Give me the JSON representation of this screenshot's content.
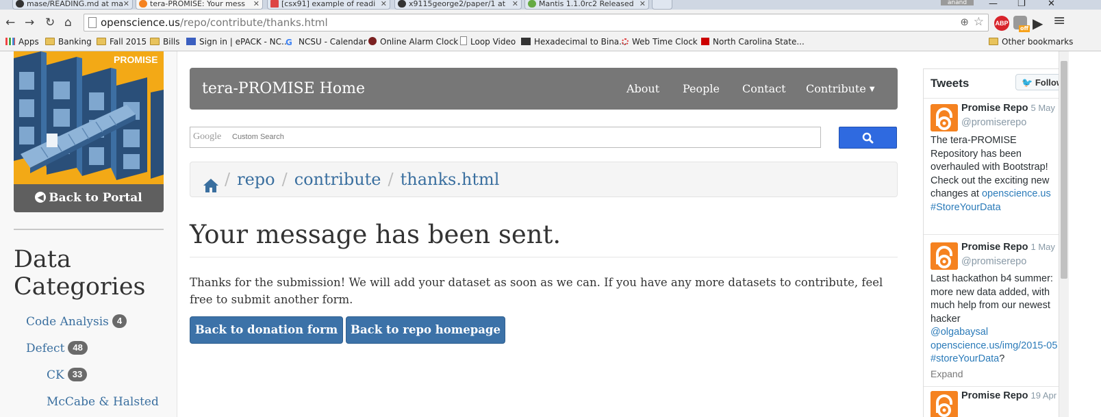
{
  "browser": {
    "tabs": [
      {
        "title": "mase/READING.md at ma",
        "active": false
      },
      {
        "title": "tera-PROMISE: Your mess",
        "active": true
      },
      {
        "title": "[csx91] example of readi",
        "active": false
      },
      {
        "title": "x9115george2/paper/1 at",
        "active": false
      },
      {
        "title": "Mantis 1.1.0rc2 Released",
        "active": false
      }
    ],
    "close_glyph": "✕",
    "user_badge": "anand",
    "url_host": "openscience.us",
    "url_path": "/repo/contribute/thanks.html",
    "bookmarks": [
      {
        "label": "Apps",
        "icon": "apps-icon"
      },
      {
        "label": "Banking",
        "icon": "folder-icon"
      },
      {
        "label": "Fall 2015",
        "icon": "folder-icon"
      },
      {
        "label": "Bills",
        "icon": "folder-icon"
      },
      {
        "label": "Sign in | ePACK - NC...",
        "icon": "epack-icon"
      },
      {
        "label": "NCSU - Calendar",
        "icon": "google-icon"
      },
      {
        "label": "Online Alarm Clock",
        "icon": "alarm-icon"
      },
      {
        "label": "Loop Video",
        "icon": "page-icon"
      },
      {
        "label": "Hexadecimal to Bina...",
        "icon": "hex-icon"
      },
      {
        "label": "Web Time Clock",
        "icon": "clock-icon"
      },
      {
        "label": "North Carolina State...",
        "icon": "ncstate-icon"
      }
    ],
    "other_bookmarks": "Other bookmarks",
    "extension_abp": "ABP",
    "extension_off": "off"
  },
  "sidebar": {
    "promise_label": "PROMISE",
    "back_to_portal": "Back to Portal",
    "heading": "Data Categories",
    "categories": [
      {
        "label": "Code Analysis",
        "count": "4",
        "level": 0
      },
      {
        "label": "Defect",
        "count": "48",
        "level": 0
      },
      {
        "label": "CK",
        "count": "33",
        "level": 1
      },
      {
        "label": "McCabe & Halsted",
        "count": "",
        "level": 1
      }
    ]
  },
  "nav": {
    "brand": "tera-PROMISE Home",
    "links": [
      "About",
      "People",
      "Contact",
      "Contribute"
    ]
  },
  "search": {
    "google_logo": "Google",
    "placeholder": "Custom Search"
  },
  "breadcrumb": [
    "repo",
    "contribute",
    "thanks.html"
  ],
  "main": {
    "headline": "Your message has been sent.",
    "body": "Thanks for the submission! We will add your dataset as soon as we can. If you have any more datasets to contribute, feel free to submit another form.",
    "button_donation": "Back to donation form",
    "button_repo": "Back to repo homepage"
  },
  "tweets": {
    "title": "Tweets",
    "follow": "Follow",
    "items": [
      {
        "name": "Promise Repo",
        "date": "5 May",
        "handle": "@promiserepo",
        "text": "The tera-PROMISE Repository has been overhauled with Bootstrap! Check out the exciting new changes at",
        "link1": "openscience.us",
        "link2": "#StoreYourData"
      },
      {
        "name": "Promise Repo",
        "date": "1 May",
        "handle": "@promiserepo",
        "text": "Last hackathon b4 summer: more new data added, with much help from our newest hacker",
        "link1": "@olgabaysal",
        "link2": "openscience.us/img/2015-05",
        "link3": "#storeYourData",
        "link3_suffix": "?",
        "expand": "Expand"
      },
      {
        "name": "Promise Repo",
        "date": "19 Apr"
      }
    ]
  }
}
